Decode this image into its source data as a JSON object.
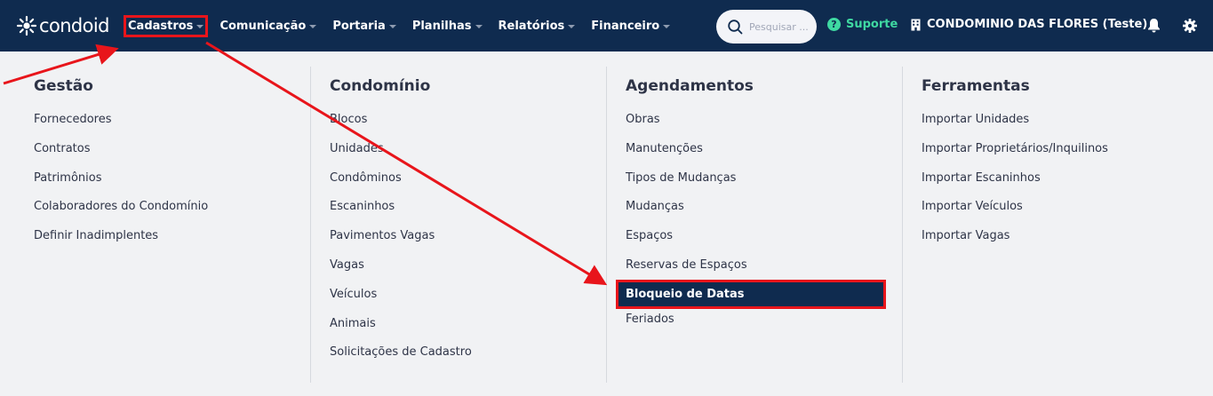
{
  "brand": {
    "name": "condoid"
  },
  "nav": [
    {
      "label": "Cadastros",
      "active": true
    },
    {
      "label": "Comunicação"
    },
    {
      "label": "Portaria"
    },
    {
      "label": "Planilhas"
    },
    {
      "label": "Relatórios"
    },
    {
      "label": "Financeiro"
    }
  ],
  "search": {
    "placeholder": "Pesquisar ..."
  },
  "support": {
    "label": "Suporte"
  },
  "condominium": {
    "name": "CONDOMINIO DAS FLORES (Teste)"
  },
  "colors": {
    "navbar": "#0f2b4f",
    "support": "#3fd9a2",
    "highlight_border": "#e8151b",
    "menu_bg": "#f1f2f4"
  },
  "menu": {
    "gestao": {
      "title": "Gestão",
      "items": [
        "Fornecedores",
        "Contratos",
        "Patrimônios",
        "Colaboradores do Condomínio",
        "Definir Inadimplentes"
      ]
    },
    "condominio": {
      "title": "Condomínio",
      "items": [
        "Blocos",
        "Unidades",
        "Condôminos",
        "Escaninhos",
        "Pavimentos Vagas",
        "Vagas",
        "Veículos",
        "Animais",
        "Solicitações de Cadastro"
      ]
    },
    "agendamentos": {
      "title": "Agendamentos",
      "items": [
        "Obras",
        "Manutenções",
        "Tipos de Mudanças",
        "Mudanças",
        "Espaços",
        "Reservas de Espaços",
        "Bloqueio de Datas",
        "Feriados"
      ]
    },
    "ferramentas": {
      "title": "Ferramentas",
      "items": [
        "Importar Unidades",
        "Importar Proprietários/Inquilinos",
        "Importar Escaninhos",
        "Importar Veículos",
        "Importar Vagas"
      ]
    }
  },
  "icons": {
    "search": "search-icon",
    "support": "question-circle-icon",
    "building": "building-icon",
    "bell": "bell-icon",
    "gear": "gear-icon"
  }
}
